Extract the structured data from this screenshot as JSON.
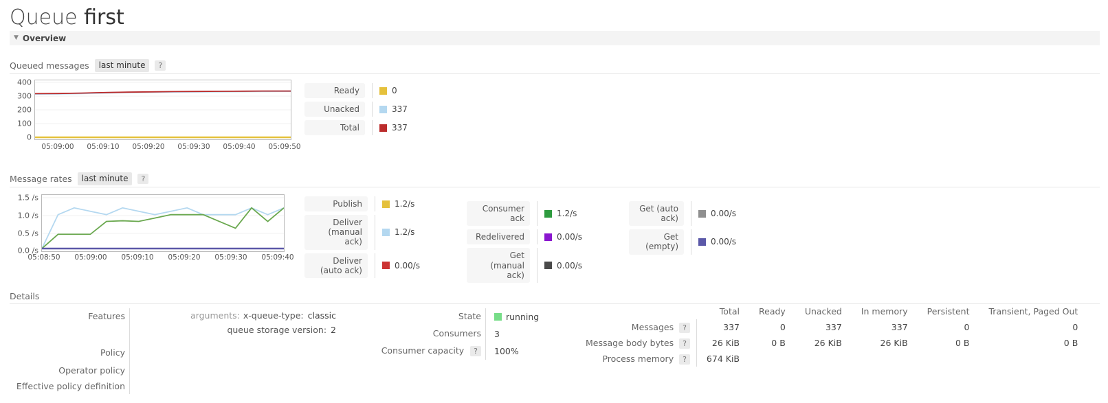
{
  "header": {
    "title_prefix": "Queue",
    "title_name": "first",
    "overview_label": "Overview",
    "collapse_icon": "triangle-down-icon"
  },
  "queued_messages": {
    "label": "Queued messages",
    "period": "last minute",
    "help": "?",
    "legend": [
      {
        "label": "Ready",
        "value": "0",
        "color": "#e5c13c"
      },
      {
        "label": "Unacked",
        "value": "337",
        "color": "#b4d8f0"
      },
      {
        "label": "Total",
        "value": "337",
        "color": "#bb2c2c"
      }
    ]
  },
  "message_rates": {
    "label": "Message rates",
    "period": "last minute",
    "help": "?",
    "legend_col1": [
      {
        "label": "Publish",
        "value": "1.2/s",
        "color": "#e5c13c"
      },
      {
        "label": "Deliver\n(manual ack)",
        "value": "1.2/s",
        "color": "#b4d8f0"
      },
      {
        "label": "Deliver\n(auto ack)",
        "value": "0.00/s",
        "color": "#cc3333"
      }
    ],
    "legend_col2": [
      {
        "label": "Consumer\nack",
        "value": "1.2/s",
        "color": "#2e9b3f"
      },
      {
        "label": "Redelivered",
        "value": "0.00/s",
        "color": "#8a16cf"
      },
      {
        "label": "Get\n(manual ack)",
        "value": "0.00/s",
        "color": "#4a4a4a"
      }
    ],
    "legend_col3": [
      {
        "label": "Get (auto\nack)",
        "value": "0.00/s",
        "color": "#8f8f8f"
      },
      {
        "label": "Get\n(empty)",
        "value": "0.00/s",
        "color": "#5b58a8"
      }
    ]
  },
  "chart_data": [
    {
      "type": "line",
      "title": "Queued messages",
      "xlabel": "",
      "ylabel": "",
      "ylim": [
        0,
        400
      ],
      "yticks": [
        "0",
        "100",
        "200",
        "300",
        "400"
      ],
      "xticks": [
        "05:09:00",
        "05:09:10",
        "05:09:20",
        "05:09:30",
        "05:09:40",
        "05:09:50"
      ],
      "grid": true,
      "legend_position": "right",
      "series": [
        {
          "name": "Total",
          "color": "#bb2c2c",
          "values": [
            318,
            319,
            322,
            326,
            329,
            331,
            333,
            334,
            335,
            336,
            337,
            337
          ]
        },
        {
          "name": "Unacked",
          "color": "#b4d8f0",
          "values": [
            316,
            317,
            320,
            324,
            327,
            329,
            331,
            332,
            333,
            334,
            335,
            336
          ]
        },
        {
          "name": "Ready",
          "color": "#e5c13c",
          "values": [
            0,
            0,
            0,
            0,
            0,
            0,
            0,
            0,
            0,
            0,
            0,
            0
          ]
        }
      ]
    },
    {
      "type": "line",
      "title": "Message rates",
      "xlabel": "",
      "ylabel": "",
      "ylim": [
        0,
        1.5
      ],
      "yticks": [
        "0.0 /s",
        "0.5 /s",
        "1.0 /s",
        "1.5 /s"
      ],
      "xticks": [
        "05:08:50",
        "05:09:00",
        "05:09:10",
        "05:09:20",
        "05:09:30",
        "05:09:40"
      ],
      "grid": true,
      "legend_position": "right",
      "series": [
        {
          "name": "Deliver (manual ack)",
          "color": "#b4d8f0",
          "values": [
            0.0,
            1.0,
            1.2,
            1.1,
            1.0,
            1.2,
            1.1,
            1.0,
            1.1,
            1.2,
            1.0,
            1.0,
            1.0,
            1.2,
            1.0,
            1.2
          ]
        },
        {
          "name": "Consumer ack",
          "color": "#6aa84f",
          "values": [
            0.0,
            0.42,
            0.42,
            0.42,
            0.8,
            0.82,
            0.8,
            0.9,
            1.0,
            1.0,
            1.0,
            0.8,
            0.6,
            1.2,
            0.8,
            1.2
          ]
        },
        {
          "name": "Get (empty)",
          "color": "#5b58a8",
          "values": [
            0,
            0,
            0,
            0,
            0,
            0,
            0,
            0,
            0,
            0,
            0,
            0,
            0,
            0,
            0,
            0
          ]
        }
      ]
    }
  ],
  "details": {
    "heading": "Details",
    "left_rows": [
      {
        "label": "Features"
      },
      {
        "label": "Policy"
      },
      {
        "label": "Operator policy"
      },
      {
        "label": "Effective policy definition"
      }
    ],
    "features": {
      "arguments_key": "arguments:",
      "arg_name": "x-queue-type:",
      "arg_value": "classic",
      "storage_key": "queue storage version:",
      "storage_value": "2"
    },
    "state_rows": [
      {
        "label": "State",
        "value": "running",
        "help": null,
        "swatch": "#77dd88"
      },
      {
        "label": "Consumers",
        "value": "3",
        "help": null,
        "swatch": null
      },
      {
        "label": "Consumer capacity",
        "value": "100%",
        "help": "?",
        "swatch": null
      }
    ],
    "stats": {
      "columns": [
        "Total",
        "Ready",
        "Unacked",
        "In memory",
        "Persistent",
        "Transient, Paged Out"
      ],
      "rows": [
        {
          "label": "Messages",
          "help": "?",
          "values": [
            "337",
            "0",
            "337",
            "337",
            "0",
            "0"
          ]
        },
        {
          "label": "Message body bytes",
          "help": "?",
          "values": [
            "26 KiB",
            "0 B",
            "26 KiB",
            "26 KiB",
            "0 B",
            "0 B"
          ]
        },
        {
          "label": "Process memory",
          "help": "?",
          "values": [
            "674 KiB",
            "",
            "",
            "",
            "",
            ""
          ]
        }
      ]
    }
  }
}
